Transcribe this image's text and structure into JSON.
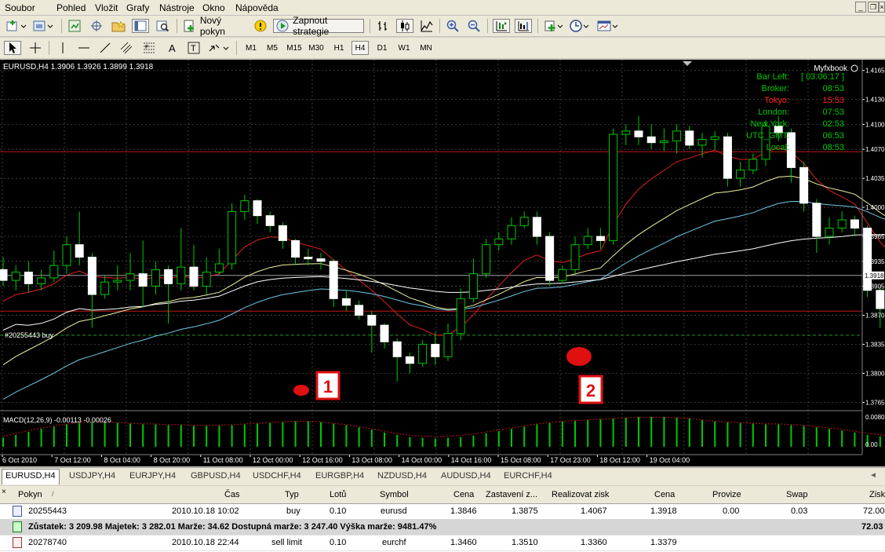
{
  "menu": {
    "items": [
      "Soubor",
      "Pohled",
      "Vložit",
      "Grafy",
      "Nástroje",
      "Okno",
      "Nápověda"
    ]
  },
  "toolbar": {
    "new_order_label": "Nový pokyn",
    "start_strategy_label": "Zapnout strategie",
    "timeframes": [
      "M1",
      "M5",
      "M15",
      "M30",
      "H1",
      "H4",
      "D1",
      "W1",
      "MN"
    ],
    "active_timeframe": "H4"
  },
  "chart": {
    "header": "EURUSD,H4  1.3906 1.3926 1.3899 1.3918",
    "order_label": "#20255443 buy",
    "indicator_label": "MACD(12,26,9) -0.00113 -0.00026",
    "brand": "Myfxbook",
    "annotation_1": "1",
    "annotation_2": "2",
    "clock": [
      {
        "name": "Bar Left:",
        "value": "[ 03:06:17 ]",
        "color": "#00c800"
      },
      {
        "name": "Broker:",
        "value": "08:53",
        "color": "#00c800"
      },
      {
        "name": "Tokyo:",
        "value": "15:53",
        "color": "#ff2020"
      },
      {
        "name": "London:",
        "value": "07:53",
        "color": "#00c800"
      },
      {
        "name": "New York:",
        "value": "02:53",
        "color": "#00c800"
      },
      {
        "name": "UTC_GMT:",
        "value": "06:53",
        "color": "#00c800"
      },
      {
        "name": "Local:",
        "value": "08:53",
        "color": "#00c800"
      }
    ]
  },
  "chart_data": {
    "type": "candlestick",
    "symbol": "EURUSD",
    "timeframe": "H4",
    "price_ticks": [
      "1.4165",
      "1.4130",
      "1.4100",
      "1.4070",
      "1.4035",
      "1.4000",
      "1.3965",
      "1.3935",
      "1.3905",
      "1.3870",
      "1.3835",
      "1.3800",
      "1.3765"
    ],
    "current_price": "1.3918",
    "time_ticks": [
      "6 Oct 2010",
      "7 Oct 12:00",
      "8 Oct 04:00",
      "8 Oct 20:00",
      "11 Oct 08:00",
      "12 Oct 00:00",
      "12 Oct 16:00",
      "13 Oct 08:00",
      "14 Oct 00:00",
      "14 Oct 16:00",
      "15 Oct 08:00",
      "17 Oct 23:00",
      "18 Oct 12:00",
      "19 Oct 04:00"
    ],
    "macd_ticks": [
      "0.00803",
      "0.00"
    ],
    "ylim": [
      1.3755,
      1.4178
    ],
    "candles": [
      [
        1.3925,
        1.3912,
        1.394,
        1.3905
      ],
      [
        1.3912,
        1.3922,
        1.393,
        1.39
      ],
      [
        1.3922,
        1.3908,
        1.3935,
        1.3898
      ],
      [
        1.3908,
        1.3915,
        1.3925,
        1.39
      ],
      [
        1.3915,
        1.393,
        1.3948,
        1.391
      ],
      [
        1.393,
        1.3955,
        1.3965,
        1.392
      ],
      [
        1.3955,
        1.394,
        1.3995,
        1.393
      ],
      [
        1.394,
        1.3895,
        1.3945,
        1.3855
      ],
      [
        1.3895,
        1.391,
        1.3918,
        1.389
      ],
      [
        1.391,
        1.3912,
        1.393,
        1.39
      ],
      [
        1.3912,
        1.392,
        1.3945,
        1.39
      ],
      [
        1.392,
        1.3905,
        1.396,
        1.388
      ],
      [
        1.3905,
        1.3925,
        1.3935,
        1.3895
      ],
      [
        1.3925,
        1.3908,
        1.393,
        1.386
      ],
      [
        1.3908,
        1.3928,
        1.3975,
        1.39
      ],
      [
        1.3928,
        1.3905,
        1.3955,
        1.39
      ],
      [
        1.3905,
        1.3922,
        1.394,
        1.3895
      ],
      [
        1.3922,
        1.3932,
        1.395,
        1.392
      ],
      [
        1.3932,
        1.3995,
        1.4005,
        1.3925
      ],
      [
        1.3995,
        1.4008,
        1.4015,
        1.3985
      ],
      [
        1.4008,
        1.399,
        1.401,
        1.398
      ],
      [
        1.399,
        1.3978,
        1.3995,
        1.397
      ],
      [
        1.3978,
        1.396,
        1.3982,
        1.395
      ],
      [
        1.396,
        1.394,
        1.3962,
        1.393
      ],
      [
        1.394,
        1.3938,
        1.395,
        1.393
      ],
      [
        1.3938,
        1.3935,
        1.3945,
        1.3925
      ],
      [
        1.3935,
        1.389,
        1.3938,
        1.388
      ],
      [
        1.389,
        1.3882,
        1.39,
        1.3875
      ],
      [
        1.3882,
        1.387,
        1.3888,
        1.3865
      ],
      [
        1.387,
        1.3858,
        1.3875,
        1.3825
      ],
      [
        1.3858,
        1.3838,
        1.386,
        1.383
      ],
      [
        1.3838,
        1.382,
        1.3842,
        1.379
      ],
      [
        1.382,
        1.3812,
        1.3825,
        1.38
      ],
      [
        1.3812,
        1.3835,
        1.384,
        1.3808
      ],
      [
        1.3835,
        1.382,
        1.385,
        1.381
      ],
      [
        1.382,
        1.3848,
        1.386,
        1.3815
      ],
      [
        1.3848,
        1.389,
        1.3902,
        1.384
      ],
      [
        1.389,
        1.392,
        1.3938,
        1.3885
      ],
      [
        1.392,
        1.3955,
        1.3962,
        1.3915
      ],
      [
        1.3955,
        1.3962,
        1.397,
        1.3948
      ],
      [
        1.3962,
        1.3978,
        1.3988,
        1.3955
      ],
      [
        1.3978,
        1.3988,
        1.3995,
        1.3975
      ],
      [
        1.3988,
        1.3965,
        1.3995,
        1.3955
      ],
      [
        1.3965,
        1.3912,
        1.397,
        1.3905
      ],
      [
        1.3912,
        1.3925,
        1.393,
        1.3908
      ],
      [
        1.3925,
        1.3955,
        1.3965,
        1.392
      ],
      [
        1.3955,
        1.3965,
        1.3975,
        1.395
      ],
      [
        1.3965,
        1.396,
        1.3975,
        1.395
      ],
      [
        1.396,
        1.4088,
        1.4095,
        1.3955
      ],
      [
        1.4088,
        1.4092,
        1.41,
        1.4075
      ],
      [
        1.4092,
        1.4085,
        1.411,
        1.4075
      ],
      [
        1.4085,
        1.4078,
        1.41,
        1.407
      ],
      [
        1.4078,
        1.408,
        1.4095,
        1.4068
      ],
      [
        1.408,
        1.4092,
        1.41,
        1.4065
      ],
      [
        1.4092,
        1.4075,
        1.4098,
        1.407
      ],
      [
        1.4075,
        1.4082,
        1.409,
        1.406
      ],
      [
        1.4082,
        1.4085,
        1.4092,
        1.407
      ],
      [
        1.4085,
        1.4035,
        1.409,
        1.4025
      ],
      [
        1.4035,
        1.4045,
        1.4055,
        1.4025
      ],
      [
        1.4045,
        1.4058,
        1.4065,
        1.404
      ],
      [
        1.4058,
        1.4098,
        1.4105,
        1.405
      ],
      [
        1.4098,
        1.409,
        1.411,
        1.408
      ],
      [
        1.409,
        1.4048,
        1.4095,
        1.403
      ],
      [
        1.4048,
        1.4005,
        1.4055,
        1.3995
      ],
      [
        1.4005,
        1.3965,
        1.401,
        1.3945
      ],
      [
        1.3965,
        1.3975,
        1.3988,
        1.3955
      ],
      [
        1.3975,
        1.3985,
        1.3995,
        1.397
      ],
      [
        1.3985,
        1.3975,
        1.399,
        1.3965
      ],
      [
        1.3975,
        1.39,
        1.3978,
        1.3892
      ],
      [
        1.39,
        1.3878,
        1.3905,
        1.3855
      ],
      [
        1.3878,
        1.3888,
        1.3895,
        1.386
      ],
      [
        1.3888,
        1.387,
        1.389,
        1.3848
      ],
      [
        1.387,
        1.39,
        1.3905,
        1.3865
      ],
      [
        1.39,
        1.3935,
        1.3948,
        1.3895
      ],
      [
        1.3935,
        1.395,
        1.3975,
        1.393
      ],
      [
        1.395,
        1.3955,
        1.3962,
        1.394
      ],
      [
        1.3955,
        1.397,
        1.3985,
        1.3948
      ],
      [
        1.397,
        1.3945,
        1.3975,
        1.394
      ],
      [
        1.3945,
        1.393,
        1.395,
        1.3925
      ],
      [
        1.393,
        1.3912,
        1.3935,
        1.3905
      ],
      [
        1.3912,
        1.3908,
        1.392,
        1.39
      ],
      [
        1.3908,
        1.3918,
        1.3926,
        1.3899
      ]
    ],
    "macd_values": [
      12,
      16,
      20,
      24,
      27,
      30,
      32,
      33,
      33,
      32,
      31,
      30,
      30,
      29,
      29,
      28,
      28,
      28,
      29,
      30,
      31,
      32,
      33,
      34,
      34,
      33,
      31,
      29,
      26,
      23,
      19,
      16,
      13,
      12,
      11,
      12,
      13,
      15,
      18,
      21,
      24,
      27,
      30,
      32,
      34,
      35,
      36,
      37,
      38,
      39,
      40,
      40,
      40,
      39,
      38,
      36,
      34,
      33,
      32,
      31,
      30,
      30,
      29,
      28,
      26,
      24,
      22,
      19,
      16,
      14,
      12,
      10,
      9,
      8,
      8,
      8,
      7,
      7,
      6,
      5,
      4,
      4
    ]
  },
  "tabs": [
    "EURUSD,H4",
    "USDJPY,H4",
    "EURJPY,H4",
    "GBPUSD,H4",
    "USDCHF,H4",
    "EURGBP,H4",
    "NZDUSD,H4",
    "AUDUSD,H4",
    "EURCHF,H4"
  ],
  "terminal": {
    "columns": [
      "Pokyn",
      "Čas",
      "Typ",
      "Lotů",
      "Symbol",
      "Cena",
      "Zastavení z...",
      "Realizovat zisk",
      "Cena",
      "Provize",
      "Swap",
      "Zisk"
    ],
    "rows": [
      {
        "pokyn": "20255443",
        "cas": "2010.10.18 10:02",
        "typ": "buy",
        "lotu": "0.10",
        "symbol": "eurusd",
        "cena": "1.3846",
        "sl": "1.3875",
        "tp": "1.4067",
        "cena2": "1.3918",
        "provize": "0.00",
        "swap": "0.03",
        "zisk": "72.00"
      },
      {
        "pokyn": "20278740",
        "cas": "2010.10.18 22:44",
        "typ": "sell limit",
        "lotu": "0.10",
        "symbol": "eurchf",
        "cena": "1.3460",
        "sl": "1.3510",
        "tp": "1.3360",
        "cena2": "1.3379",
        "provize": "",
        "swap": "",
        "zisk": ""
      }
    ],
    "summary": "Zůstatek: 3 209.98  Majetek: 3 282.01  Marže: 34.62  Dostupná marže: 3 247.40  Výška marže: 9481.47%",
    "summary_profit": "72.03"
  }
}
